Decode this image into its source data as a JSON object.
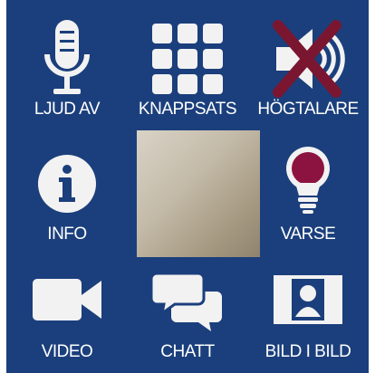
{
  "buttons": {
    "mute": {
      "label": "LJUD AV",
      "icon": "microphone-icon"
    },
    "keypad": {
      "label": "KNAPPSATS",
      "icon": "keypad-grid-icon"
    },
    "speaker": {
      "label": "HÖGTALARE",
      "icon": "speaker-off-icon"
    },
    "info": {
      "label": "INFO",
      "icon": "info-icon"
    },
    "alert": {
      "label": "VARSE",
      "icon": "lightbulb-icon"
    },
    "video": {
      "label": "VIDEO",
      "icon": "video-camera-icon"
    },
    "chat": {
      "label": "CHATT",
      "icon": "chat-bubbles-icon"
    },
    "pip": {
      "label": "BILD I BILD",
      "icon": "picture-in-picture-icon"
    }
  },
  "colors": {
    "background": "#1b3f7c",
    "icon": "#f2f2f2",
    "speaker_off_cross": "#7a1630",
    "alert_bulb": "#8c1340"
  }
}
